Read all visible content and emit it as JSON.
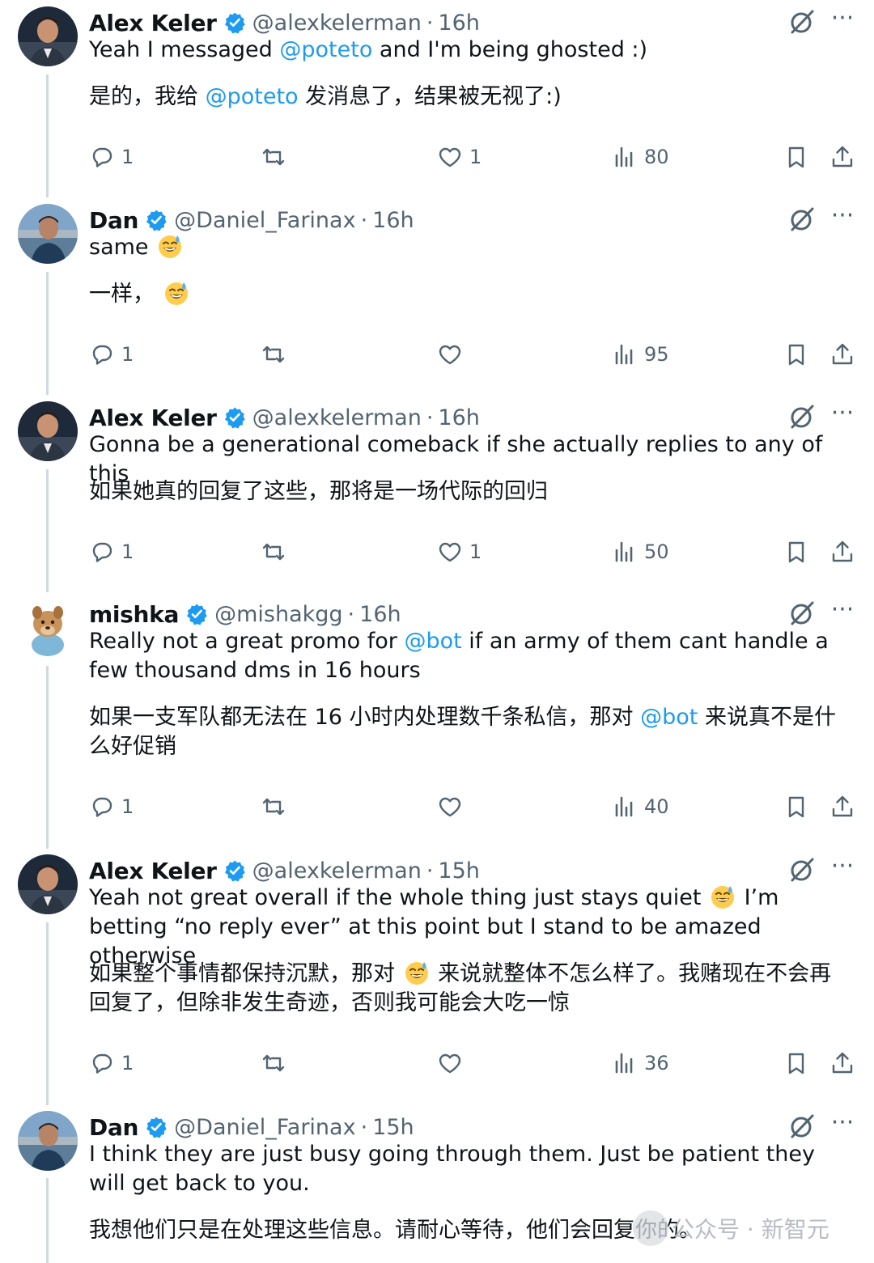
{
  "colors": {
    "accent": "#1d9bf0",
    "muted": "#536471",
    "text": "#0f1419",
    "thread_line": "#cfd9de"
  },
  "watermark": {
    "text": "公众号 · 新智元"
  },
  "tweets": [
    {
      "name": "Alex Keler",
      "handle": "@alexkelerman",
      "dot": "·",
      "time": "16h",
      "en_parts": [
        "Yeah I messaged ",
        "@poteto",
        " and I'm being ghosted :)"
      ],
      "zh_parts": [
        "是的，我给 ",
        "@poteto",
        " 发消息了，结果被无视了:)"
      ],
      "replies": "1",
      "retweets": "",
      "likes": "1",
      "views": "80"
    },
    {
      "name": "Dan",
      "handle": "@Daniel_Farinax",
      "dot": "·",
      "time": "16h",
      "en_parts": [
        "same "
      ],
      "zh_parts": [
        "一样，  "
      ],
      "replies": "1",
      "retweets": "",
      "likes": "",
      "views": "95"
    },
    {
      "name": "Alex Keler",
      "handle": "@alexkelerman",
      "dot": "·",
      "time": "16h",
      "en_parts": [
        "Gonna be a generational comeback if she actually replies to any of this"
      ],
      "zh_parts": [
        "如果她真的回复了这些，那将是一场代际的回归"
      ],
      "replies": "1",
      "retweets": "",
      "likes": "1",
      "views": "50"
    },
    {
      "name": "mishka",
      "handle": "@mishakgg",
      "dot": "·",
      "time": "16h",
      "en_parts": [
        "Really not a great promo for ",
        "@bot",
        " if an army of them cant handle a few thousand dms in 16 hours"
      ],
      "zh_parts": [
        "如果一支军队都无法在 16 小时内处理数千条私信，那对 ",
        "@bot",
        " 来说真不是什么好促销"
      ],
      "replies": "1",
      "retweets": "",
      "likes": "",
      "views": "40"
    },
    {
      "name": "Alex Keler",
      "handle": "@alexkelerman",
      "dot": "·",
      "time": "15h",
      "en_parts": [
        "Yeah not great overall if the whole thing just stays quiet ",
        " I’m betting “no reply ever” at this point but I stand to be amazed otherwise"
      ],
      "zh_parts": [
        "如果整个事情都保持沉默，那对 ",
        " 来说就整体不怎么样了。我赌现在不会再回复了，但除非发生奇迹，否则我可能会大吃一惊"
      ],
      "replies": "1",
      "retweets": "",
      "likes": "",
      "views": "36"
    },
    {
      "name": "Dan",
      "handle": "@Daniel_Farinax",
      "dot": "·",
      "time": "15h",
      "en_parts": [
        "I think they are just busy going through them. Just be patient they will get back to you."
      ],
      "zh_parts": [
        "我想他们只是在处理这些信息。请耐心等待，他们会回复你的。"
      ],
      "replies": "",
      "retweets": "",
      "likes": "",
      "views": ""
    }
  ]
}
